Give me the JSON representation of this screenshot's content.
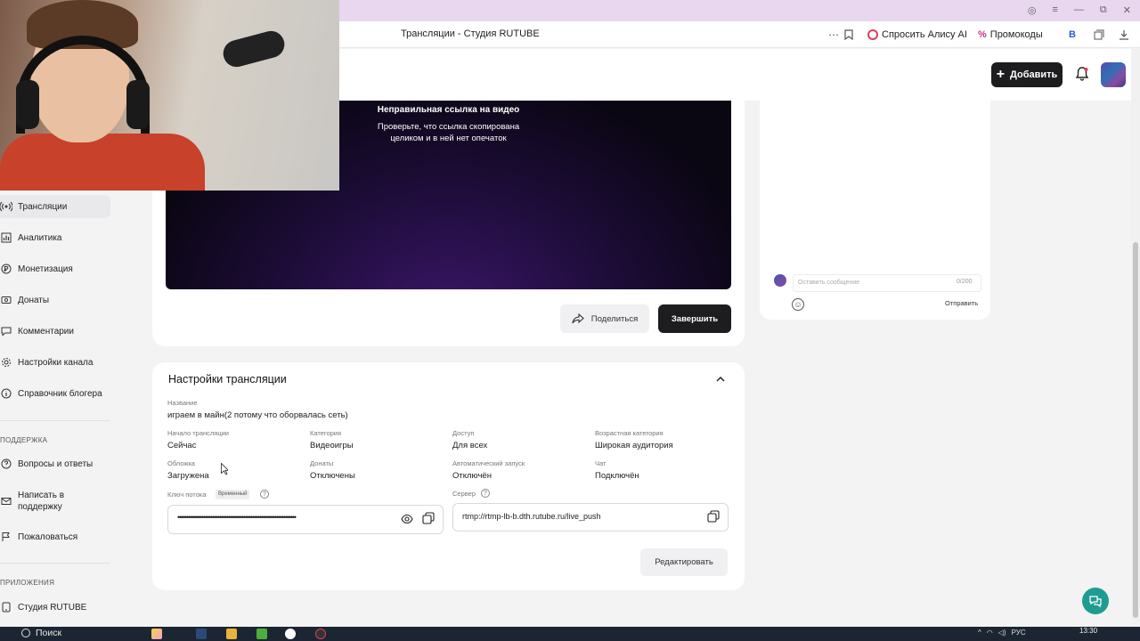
{
  "browser": {
    "tab_title": "Трансляции - Студия RUTUBE",
    "alice_label": "Спросить Алису AI",
    "promo_label": "Промокоды",
    "vk_label": "B"
  },
  "header": {
    "add_label": "Добавить"
  },
  "sidebar": {
    "items": [
      {
        "label": "Трансляции",
        "icon": "broadcast-icon"
      },
      {
        "label": "Аналитика",
        "icon": "chart-icon"
      },
      {
        "label": "Монетизация",
        "icon": "coin-icon"
      },
      {
        "label": "Донаты",
        "icon": "donate-icon"
      },
      {
        "label": "Комментарии",
        "icon": "comment-icon"
      },
      {
        "label": "Настройки канала",
        "icon": "gear-icon"
      },
      {
        "label": "Справочник блогера",
        "icon": "info-icon"
      }
    ],
    "support_header": "ПОДДЕРЖКА",
    "support_items": [
      {
        "label": "Вопросы и ответы",
        "icon": "help-icon"
      },
      {
        "label": "Написать в поддержку",
        "icon": "mail-icon"
      },
      {
        "label": "Пожаловаться",
        "icon": "flag-icon"
      }
    ],
    "apps_header": "ПРИЛОЖЕНИЯ",
    "apps_items": [
      {
        "label": "Студия RUTUBE",
        "icon": "studio-icon"
      }
    ]
  },
  "player": {
    "error_title": "Неправильная ссылка на видео",
    "error_line1": "Проверьте, что ссылка скопирована",
    "error_line2": "целиком и в ней нет опечаток",
    "share_label": "Поделиться",
    "finish_label": "Завершить"
  },
  "chat": {
    "placeholder": "Оставить сообщение",
    "counter": "0/200",
    "send_label": "Отправить"
  },
  "settings": {
    "title": "Настройки трансляции",
    "name_label": "Название",
    "name_value": "играем в майн(2 потому что оборвалась сеть)",
    "fields": [
      {
        "label": "Начало трансляции",
        "value": "Сейчас"
      },
      {
        "label": "Категория",
        "value": "Видеоигры"
      },
      {
        "label": "Доступ",
        "value": "Для всех"
      },
      {
        "label": "Возрастная категория",
        "value": "Широкая аудитория"
      },
      {
        "label": "Обложка",
        "value": "Загружена"
      },
      {
        "label": "Донаты",
        "value": "Отключены"
      },
      {
        "label": "Автоматический запуск",
        "value": "Отключён"
      },
      {
        "label": "Чат",
        "value": "Подключён"
      }
    ],
    "key_label": "Ключ потока",
    "key_badge": "Временный",
    "key_value": "••••••••••••••••••••••••••••••••••••••••••••••••••••••••••••••••••••",
    "server_label": "Сервер",
    "server_value": "rtmp://rtmp-lb-b.dth.rutube.ru/live_push",
    "edit_label": "Редактировать"
  },
  "taskbar": {
    "search_label": "Поиск",
    "lang": "РУС",
    "time": "13:30"
  },
  "colors": {
    "accent_dark": "#1d1d1f",
    "fab": "#1f9c91",
    "alice": "#e03c5a"
  }
}
